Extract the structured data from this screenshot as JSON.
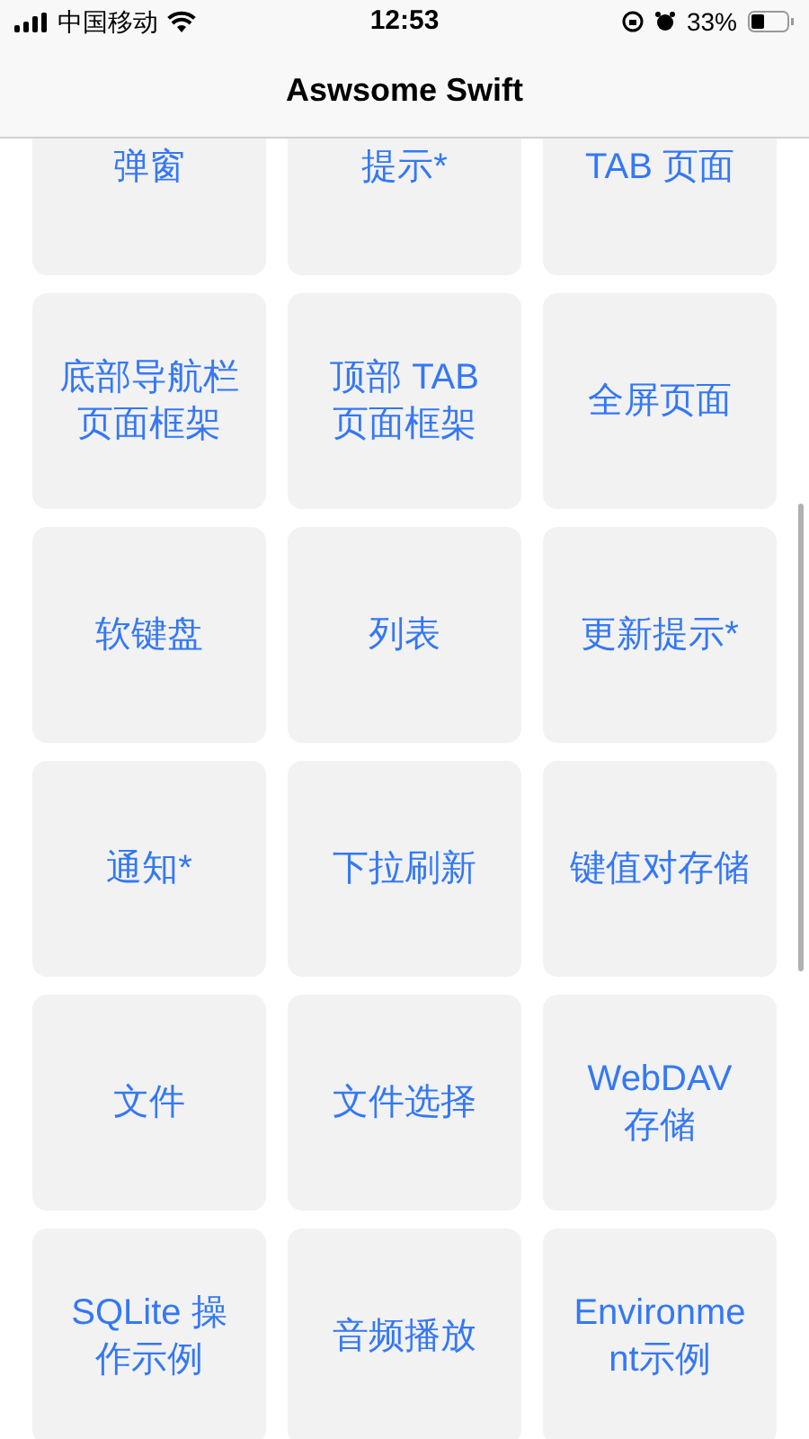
{
  "status_bar": {
    "carrier": "中国移动",
    "time": "12:53",
    "battery": "33%"
  },
  "nav_bar": {
    "title": "Aswsome Swift"
  },
  "grid": [
    {
      "label": "弹窗"
    },
    {
      "label": "提示*"
    },
    {
      "label": "TAB 页面"
    },
    {
      "label": "底部导航栏页面框架"
    },
    {
      "label": "顶部 TAB 页面框架"
    },
    {
      "label": "全屏页面"
    },
    {
      "label": "软键盘"
    },
    {
      "label": "列表"
    },
    {
      "label": "更新提示*"
    },
    {
      "label": "通知*"
    },
    {
      "label": "下拉刷新"
    },
    {
      "label": "键值对存储"
    },
    {
      "label": "文件"
    },
    {
      "label": "文件选择"
    },
    {
      "label": "WebDAV 存储"
    },
    {
      "label": "SQLite 操作示例"
    },
    {
      "label": "音频播放"
    },
    {
      "label": "Environment示例"
    }
  ]
}
